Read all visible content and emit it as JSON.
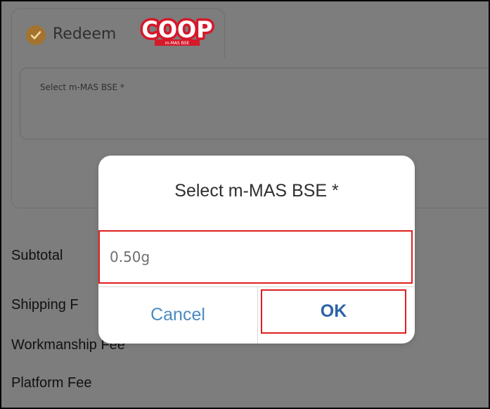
{
  "tab": {
    "label": "Redeem",
    "logo_text": "COOP",
    "logo_subtext": "m-MAS BSE",
    "check_color": "#a3732f",
    "logo_color": "#d6182a"
  },
  "selector": {
    "label": "Select m-MAS BSE *"
  },
  "fees": {
    "subtotal": "Subtotal",
    "shipping": "Shipping F",
    "workmanship": "Workmanship Fee",
    "platform": "Platform Fee"
  },
  "modal": {
    "title": "Select m-MAS BSE *",
    "option_value": "0.50g",
    "cancel_label": "Cancel",
    "ok_label": "OK"
  }
}
